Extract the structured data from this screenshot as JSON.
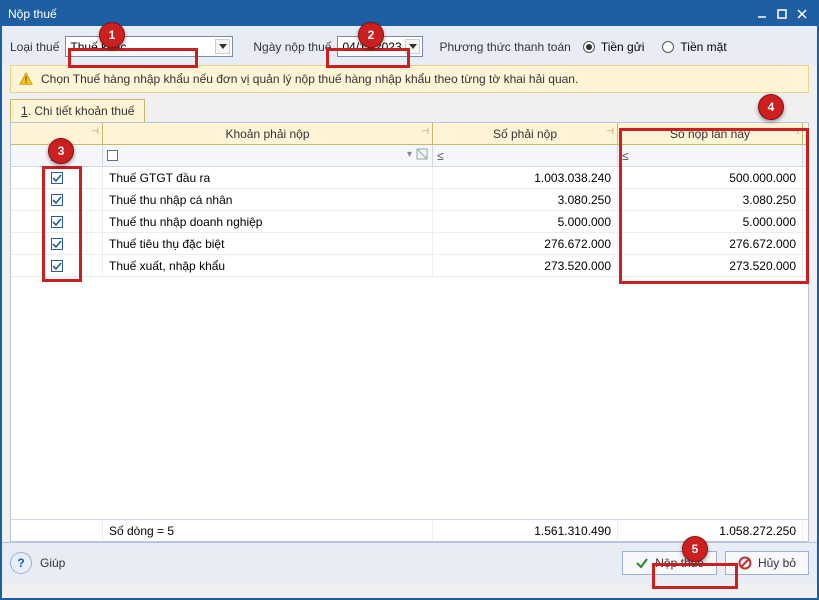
{
  "window": {
    "title": "Nộp thuế"
  },
  "form": {
    "tax_type_label": "Loại thuế",
    "tax_type_value": "Thuế khác",
    "date_label": "Ngày nộp thuế",
    "date_value": "04/11/2023",
    "pay_method_label": "Phương thức thanh toán",
    "radio1": "Tiền gửi",
    "radio2": "Tiền mặt"
  },
  "banner": {
    "text": "Chọn Thuế hàng nhập khẩu nếu đơn vị quản lý nộp thuế hàng nhập khẩu theo từng tờ khai hải quan."
  },
  "tab": {
    "label_num": "1",
    "label_rest": ". Chi tiết khoản thuế"
  },
  "columns": {
    "check": "",
    "name": "Khoản phải nộp",
    "due": "Số phải nộp",
    "pay": "Số nộp lần này"
  },
  "filter_le": "≤",
  "rows": [
    {
      "checked": true,
      "name": "Thuế GTGT đầu ra",
      "due": "1.003.038.240",
      "pay": "500.000.000"
    },
    {
      "checked": true,
      "name": "Thuế thu nhập cá nhân",
      "due": "3.080.250",
      "pay": "3.080.250"
    },
    {
      "checked": true,
      "name": "Thuế thu nhập doanh nghiệp",
      "due": "5.000.000",
      "pay": "5.000.000"
    },
    {
      "checked": true,
      "name": "Thuế tiêu thụ đặc biệt",
      "due": "276.672.000",
      "pay": "276.672.000"
    },
    {
      "checked": true,
      "name": "Thuế xuất, nhập khẩu",
      "due": "273.520.000",
      "pay": "273.520.000"
    }
  ],
  "footer": {
    "count_label": "Số dòng = 5",
    "sum_due": "1.561.310.490",
    "sum_pay": "1.058.272.250"
  },
  "buttons": {
    "help": "Giúp",
    "submit": "Nộp thuế",
    "cancel": "Hủy bỏ"
  },
  "callouts": {
    "c1": "1",
    "c2": "2",
    "c3": "3",
    "c4": "4",
    "c5": "5"
  }
}
